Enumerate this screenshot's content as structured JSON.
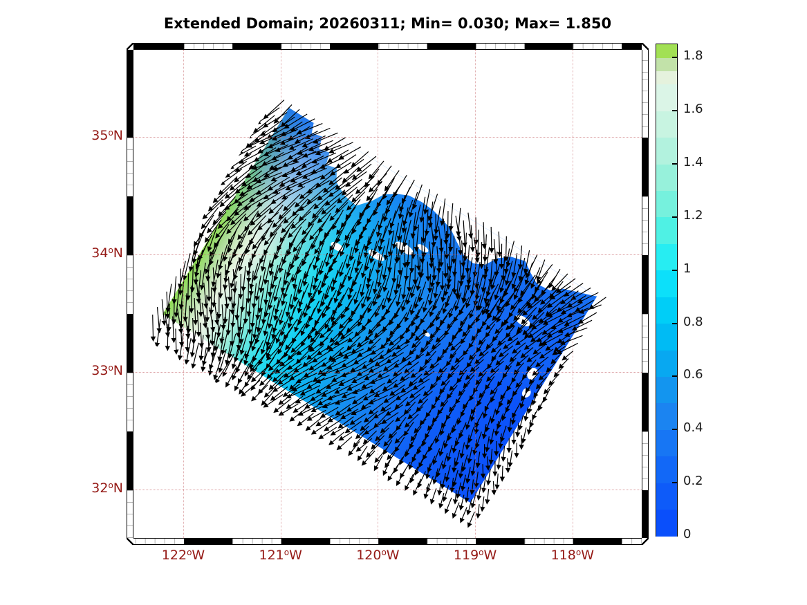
{
  "title": "Extended Domain; 20260311; Min= 0.030; Max= 1.850",
  "colors": {
    "axis_label": "#951a16",
    "grid_dotted": "rgba(199,106,110,0.6)",
    "arrow": "#000000",
    "land": "#ffffff",
    "frame_black": "#000000"
  },
  "x_ticks": [
    {
      "deg": "122",
      "sup": "o",
      "hemi": "W",
      "value": 122
    },
    {
      "deg": "121",
      "sup": "o",
      "hemi": "W",
      "value": 121
    },
    {
      "deg": "120",
      "sup": "o",
      "hemi": "W",
      "value": 120
    },
    {
      "deg": "119",
      "sup": "o",
      "hemi": "W",
      "value": 119
    },
    {
      "deg": "118",
      "sup": "o",
      "hemi": "W",
      "value": 118
    }
  ],
  "y_ticks": [
    {
      "deg": "35",
      "sup": "o",
      "hemi": "N",
      "value": 35
    },
    {
      "deg": "34",
      "sup": "o",
      "hemi": "N",
      "value": 34
    },
    {
      "deg": "33",
      "sup": "o",
      "hemi": "N",
      "value": 33
    },
    {
      "deg": "32",
      "sup": "o",
      "hemi": "N",
      "value": 32
    }
  ],
  "colorbar": {
    "range": [
      0,
      1.85
    ],
    "ticks": [
      {
        "label": "1.8",
        "value": 1.8
      },
      {
        "label": "1.6",
        "value": 1.6
      },
      {
        "label": "1.4",
        "value": 1.4
      },
      {
        "label": "1.2",
        "value": 1.2
      },
      {
        "label": "1",
        "value": 1.0
      },
      {
        "label": "0.8",
        "value": 0.8
      },
      {
        "label": "0.6",
        "value": 0.6
      },
      {
        "label": "0.4",
        "value": 0.4
      },
      {
        "label": "0.2",
        "value": 0.2
      },
      {
        "label": "0",
        "value": 0.0
      }
    ],
    "bands": [
      {
        "v0": 0.0,
        "v1": 0.1,
        "color": "#0a4ffb"
      },
      {
        "v0": 0.1,
        "v1": 0.2,
        "color": "#0e5bf9"
      },
      {
        "v0": 0.2,
        "v1": 0.3,
        "color": "#1268f7"
      },
      {
        "v0": 0.3,
        "v1": 0.4,
        "color": "#1776f4"
      },
      {
        "v0": 0.4,
        "v1": 0.5,
        "color": "#1b84f1"
      },
      {
        "v0": 0.5,
        "v1": 0.6,
        "color": "#1395ef"
      },
      {
        "v0": 0.6,
        "v1": 0.7,
        "color": "#08a8f1"
      },
      {
        "v0": 0.7,
        "v1": 0.8,
        "color": "#00bbf4"
      },
      {
        "v0": 0.8,
        "v1": 0.9,
        "color": "#00cef7"
      },
      {
        "v0": 0.9,
        "v1": 1.0,
        "color": "#0ce0fa"
      },
      {
        "v0": 1.0,
        "v1": 1.1,
        "color": "#27edf2"
      },
      {
        "v0": 1.1,
        "v1": 1.2,
        "color": "#4ff1e4"
      },
      {
        "v0": 1.2,
        "v1": 1.3,
        "color": "#76f1dd"
      },
      {
        "v0": 1.3,
        "v1": 1.4,
        "color": "#97f1db"
      },
      {
        "v0": 1.4,
        "v1": 1.5,
        "color": "#b2f2de"
      },
      {
        "v0": 1.5,
        "v1": 1.6,
        "color": "#c8f4e1"
      },
      {
        "v0": 1.6,
        "v1": 1.7,
        "color": "#dbf5e7"
      },
      {
        "v0": 1.7,
        "v1": 1.75,
        "color": "#e5f2dd"
      },
      {
        "v0": 1.75,
        "v1": 1.8,
        "color": "#c2e2a9"
      },
      {
        "v0": 1.8,
        "v1": 1.85,
        "color": "#a2e054"
      }
    ]
  },
  "map": {
    "land_pct": [
      [
        8,
        0
      ],
      [
        9,
        4
      ],
      [
        12,
        3
      ],
      [
        13,
        8
      ],
      [
        16,
        7
      ],
      [
        17,
        12
      ],
      [
        20,
        11
      ],
      [
        22,
        16
      ],
      [
        26,
        19
      ],
      [
        30,
        20
      ],
      [
        33,
        15
      ],
      [
        35,
        10
      ],
      [
        38,
        7
      ],
      [
        41,
        5
      ],
      [
        45,
        4.5
      ],
      [
        49,
        5
      ],
      [
        53,
        6.5
      ],
      [
        56,
        8
      ],
      [
        59,
        11
      ],
      [
        63,
        14.5
      ],
      [
        66,
        15
      ],
      [
        69,
        13
      ],
      [
        71,
        8
      ],
      [
        74,
        4.5
      ],
      [
        78,
        3
      ],
      [
        81,
        6
      ],
      [
        84,
        8.5
      ],
      [
        88,
        8
      ],
      [
        91,
        4.5
      ],
      [
        95,
        2.5
      ],
      [
        100,
        0
      ]
    ],
    "islands": [
      [
        164,
        135,
        10,
        5
      ],
      [
        219,
        116,
        13,
        5
      ],
      [
        248,
        86,
        15,
        6
      ],
      [
        271,
        72,
        9,
        4
      ],
      [
        340,
        175,
        6,
        3
      ],
      [
        449,
        86,
        12,
        6
      ],
      [
        501,
        144,
        7,
        9
      ],
      [
        508,
        172,
        6,
        7
      ]
    ],
    "arrows": {
      "color": "#000000",
      "grid_step": 13,
      "base_angle_deg": 90,
      "length_range": [
        15,
        40
      ]
    }
  },
  "chart_data": {
    "type": "heatmap",
    "subtype": "quiver vector field over speed heatmap on rotated model domain (map)",
    "title": "Extended Domain; 20260311; Min= 0.030; Max= 1.850",
    "date_shown": "20260311",
    "field_min": 0.03,
    "field_max": 1.85,
    "x_axis": {
      "tick_labels": [
        "122°W",
        "121°W",
        "120°W",
        "119°W",
        "118°W"
      ],
      "tick_values_deg_west": [
        122,
        121,
        120,
        119,
        118
      ],
      "approx_range_deg_west": [
        122.6,
        117.2
      ]
    },
    "y_axis": {
      "tick_labels": [
        "35°N",
        "34°N",
        "33°N",
        "32°N"
      ],
      "tick_values_deg_north": [
        35,
        34,
        33,
        32
      ],
      "approx_range_deg_north": [
        31.55,
        35.85
      ]
    },
    "colorbar": {
      "tick_labels": [
        "0",
        "0.2",
        "0.4",
        "0.6",
        "0.8",
        "1",
        "1.2",
        "1.4",
        "1.6",
        "1.8"
      ],
      "range": [
        0,
        1.85
      ],
      "position": "right",
      "style": "stepped blue-cyan-green colormap"
    },
    "grid": "dotted 1-degree graticule, dark-red tick labels, black/white checkered map frame",
    "region_description": "Rotated rectangular ocean model domain over the Southern California Bight (Point Conception to San Diego). Speed field highest (~1.8, green) along offshore southwest edge, decreasing through cyan (~1.0) to blue (~0-0.3) toward the coast. Dense black arrows (currents) point generally south-southwestward, extending over white land mask and past domain edges. White cutouts: mainland coast and Channel Islands (San Miguel, Santa Rosa, Santa Cruz, Anacapa, Santa Barbara, Catalina, San Clemente)."
  }
}
